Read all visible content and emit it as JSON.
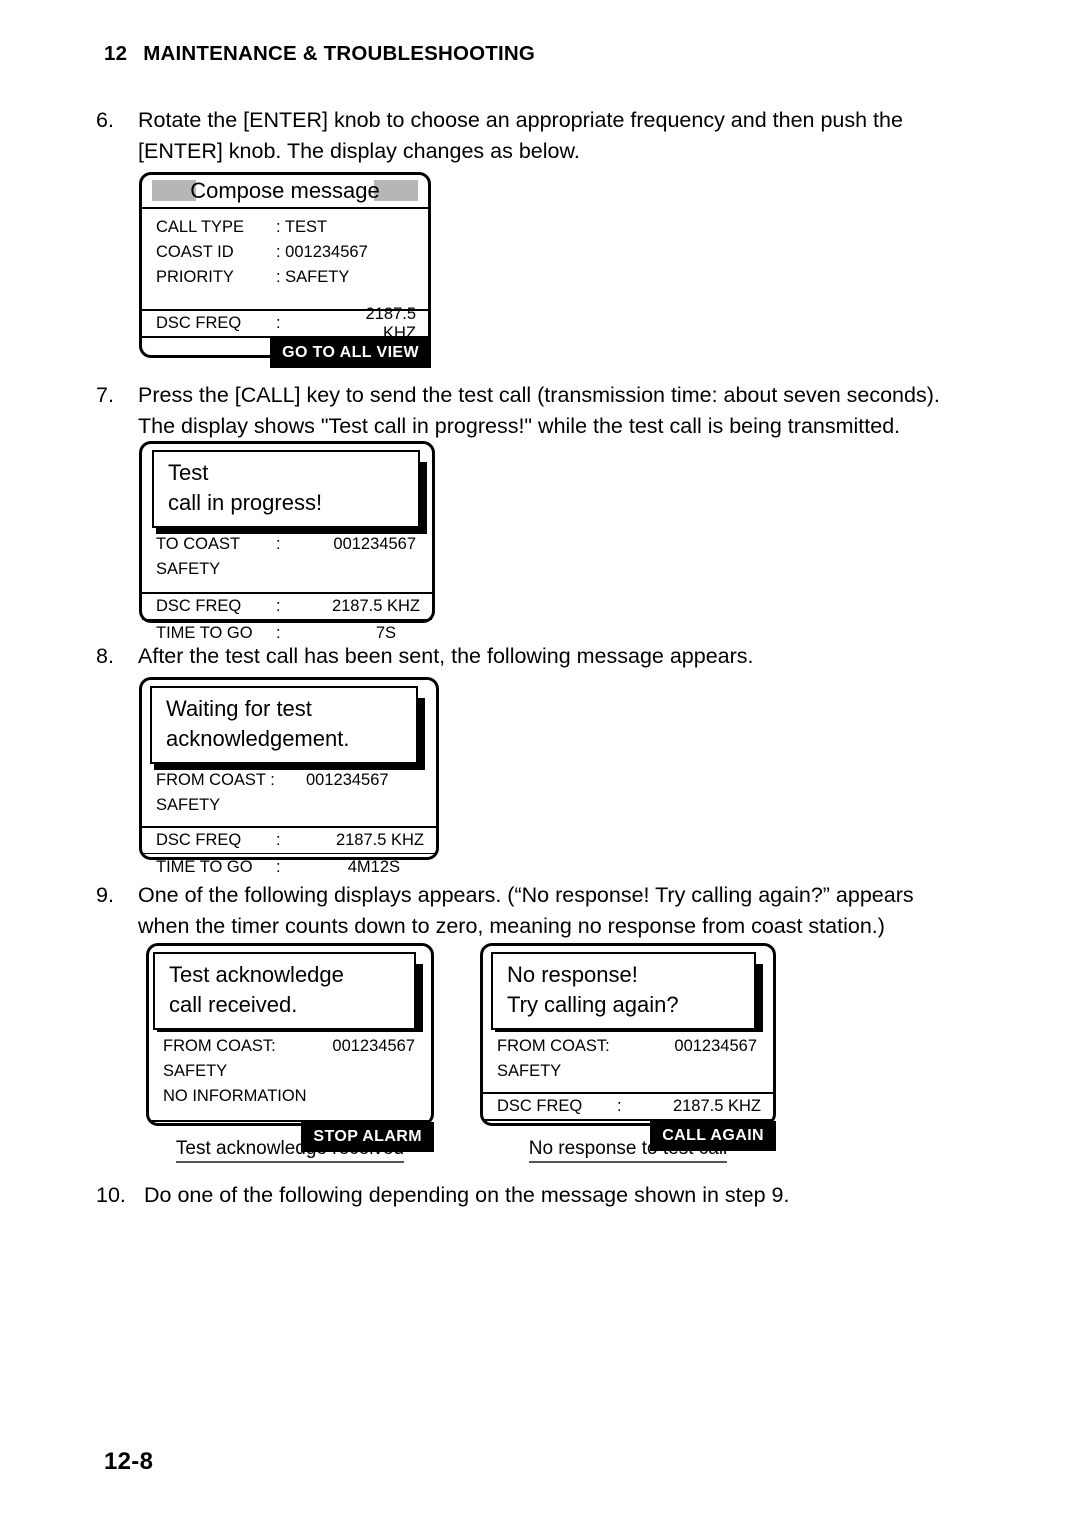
{
  "header": {
    "chapter_number": "12",
    "chapter_title": "MAINTENANCE & TROUBLESHOOTING"
  },
  "page_number": "12-8",
  "steps": [
    {
      "marker": "6.",
      "lines": [
        "Rotate the [ENTER] knob to choose an appropriate frequency and then push the",
        "[ENTER] knob. The display changes as below."
      ]
    },
    {
      "marker": "7.",
      "lines": [
        "Press the [CALL] key to send the test call (transmission time: about seven seconds).",
        "The display shows \"Test call in progress!\" while the test call is being transmitted."
      ]
    },
    {
      "marker": "8.",
      "lines": [
        "After the test call has been sent, the following message appears."
      ]
    },
    {
      "marker": "9.",
      "lines": [
        "One of the following displays appears. (“No response! Try calling again?” appears",
        "when the timer counts down to zero, meaning no response from coast station.)"
      ]
    },
    {
      "marker": "10.",
      "lines": [
        "Do one of the following depending on the message shown in step 9."
      ]
    }
  ],
  "displays": {
    "compose": {
      "title": "Compose message",
      "fields": [
        {
          "key": "CALL TYPE",
          "value": ": TEST"
        },
        {
          "key": "COAST ID",
          "value": ": 001234567"
        },
        {
          "key": "PRIORITY",
          "value": ": SAFETY"
        }
      ],
      "freq": {
        "key": "DSC FREQ",
        "colon": ":",
        "value": "2187.5 KHZ"
      },
      "softkey": "GO TO ALL VIEW"
    },
    "in_progress": {
      "popup": [
        "Test",
        "call in progress!"
      ],
      "fields": [
        {
          "key": "TO COAST",
          "colon": ":",
          "value": "001234567"
        },
        {
          "key": "SAFETY",
          "colon": "",
          "value": ""
        }
      ],
      "freq": {
        "key": "DSC FREQ",
        "colon": ":",
        "value": "2187.5 KHZ"
      },
      "time": {
        "key": "TIME TO GO",
        "colon": ":",
        "value": "7S"
      }
    },
    "waiting": {
      "popup": [
        "Waiting for test",
        "acknowledgement."
      ],
      "fields": [
        {
          "key": "FROM COAST :",
          "colon": "",
          "value": "001234567"
        },
        {
          "key": "SAFETY",
          "colon": "",
          "value": ""
        }
      ],
      "freq": {
        "key": "DSC FREQ",
        "colon": ":",
        "value": "2187.5 KHZ"
      },
      "time": {
        "key": "TIME TO GO",
        "colon": ":",
        "value": "4M12S"
      }
    },
    "acknowledge": {
      "popup": [
        "Test acknowledge",
        "call received."
      ],
      "fields": [
        {
          "key": "FROM COAST:",
          "colon": "",
          "value": "001234567"
        },
        {
          "key": "SAFETY",
          "colon": "",
          "value": ""
        },
        {
          "key": "NO INFORMATION",
          "colon": "",
          "value": ""
        }
      ],
      "softkey": "STOP ALARM",
      "caption": "Test acknowledge received"
    },
    "no_response": {
      "popup": [
        "No response!",
        "Try calling again?"
      ],
      "fields": [
        {
          "key": "FROM COAST:",
          "colon": "",
          "value": "001234567"
        },
        {
          "key": "SAFETY",
          "colon": "",
          "value": ""
        }
      ],
      "freq": {
        "key": "DSC FREQ",
        "colon": ":",
        "value": "2187.5 KHZ"
      },
      "softkey": "CALL AGAIN",
      "caption": "No response to test call"
    }
  }
}
